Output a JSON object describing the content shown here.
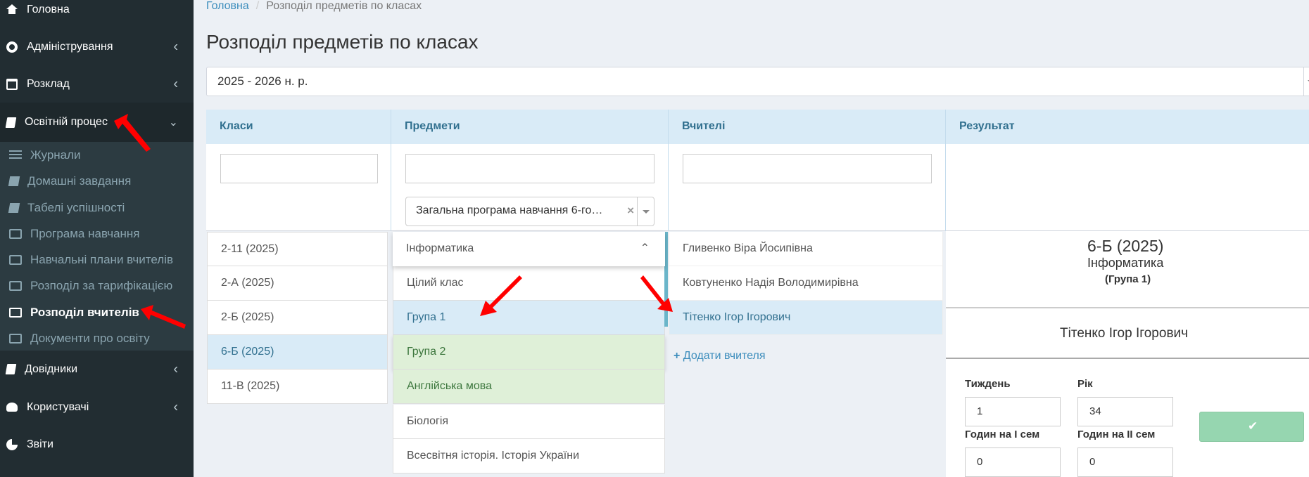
{
  "sidebar": {
    "items": [
      {
        "label": "Головна"
      },
      {
        "label": "Адміністрування"
      },
      {
        "label": "Розклад"
      },
      {
        "label": "Освітній процес"
      },
      {
        "label": "Довідники"
      },
      {
        "label": "Користувачі"
      },
      {
        "label": "Звіти"
      }
    ],
    "sub": [
      {
        "label": "Журнали"
      },
      {
        "label": "Домашні завдання"
      },
      {
        "label": "Табелі успішності"
      },
      {
        "label": "Програма навчання"
      },
      {
        "label": "Навчальні плани вчителів"
      },
      {
        "label": "Розподіл за тарифікацією"
      },
      {
        "label": "Розподіл вчителів"
      },
      {
        "label": "Документи про освіту"
      }
    ]
  },
  "breadcrumb": {
    "home": "Головна",
    "current": "Розподіл предметів по класах"
  },
  "page_title": "Розподіл предметів по класах",
  "year_select": "2025 - 2026 н. р.",
  "columns": {
    "classes": "Класи",
    "subjects": "Предмети",
    "teachers": "Вчителі",
    "result": "Результат"
  },
  "program_select": "Загальна програма навчання 6-го…",
  "classes": [
    "2-11 (2025)",
    "2-А (2025)",
    "2-Б (2025)",
    "6-Б (2025)",
    "11-В (2025)"
  ],
  "subject_selected": "Інформатика",
  "subjects": [
    "Цілий клас",
    "Група 1",
    "Група 2",
    "Англійська мова",
    "Біологія",
    "Всесвітня історія. Історія України"
  ],
  "teachers": [
    "Гливенко Віра Йосипівна",
    "Ковтуненко Надія Володимирівна",
    "Тітенко Ігор Ігорович"
  ],
  "add_teacher": "Додати вчителя",
  "result": {
    "class": "6-Б (2025)",
    "subject": "Інформатика",
    "group": "(Група 1)",
    "teacher": "Тітенко Ігор Ігорович",
    "week_label": "Тиждень",
    "week_value": "1",
    "year_label": "Рік",
    "year_value": "34",
    "sem1_label": "Годин на І сем",
    "sem1_value": "0",
    "sem2_label": "Годин на ІІ сем",
    "sem2_value": "0"
  },
  "colors": {
    "sidebar": "#222d32",
    "accent": "#3c8dbc",
    "active_blue": "#d9ebf7",
    "active_green": "#dff0d8",
    "save_button": "#96d6b0",
    "arrow": "#ff0000"
  }
}
